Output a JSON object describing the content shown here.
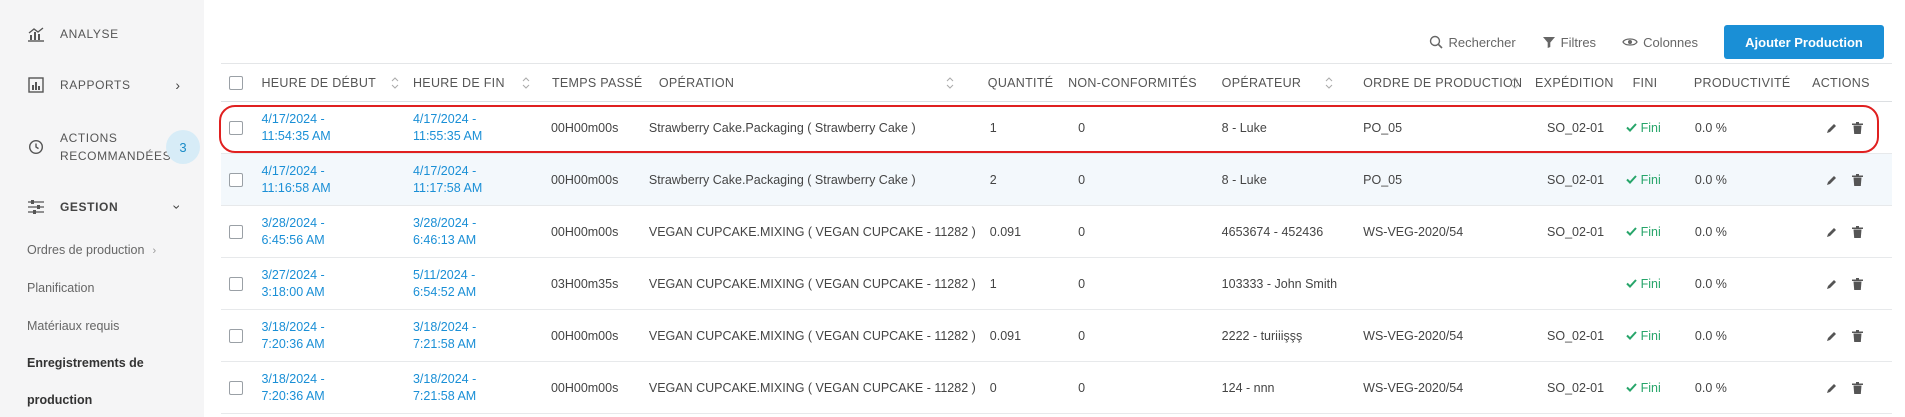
{
  "sidebar": {
    "analyse": "ANALYSE",
    "rapports": "RAPPORTS",
    "actions_line1": "ACTIONS",
    "actions_line2": "RECOMMANDÉES",
    "actions_badge": "3",
    "gestion": "GESTION",
    "sub_items": [
      "Ordres de production",
      "Planification",
      "Matériaux requis"
    ],
    "active_line1": "Enregistrements de",
    "active_line2": "production"
  },
  "toolbar": {
    "search": "Rechercher",
    "filters": "Filtres",
    "columns": "Colonnes",
    "add": "Ajouter Production"
  },
  "table": {
    "headers": [
      "HEURE DE DÉBUT",
      "HEURE DE FIN",
      "TEMPS PASSÉ",
      "OPÉRATION",
      "QUANTITÉ",
      "NON-CONFORMITÉS",
      "OPÉRATEUR",
      "ORDRE DE PRODUCTION",
      "EXPÉDITION",
      "FINI",
      "PRODUCTIVITÉ",
      "ACTIONS"
    ],
    "rows": [
      {
        "start1": "4/17/2024 -",
        "start2": "11:54:35 AM",
        "end1": "4/17/2024 -",
        "end2": "11:55:35 AM",
        "time": "00H00m00s",
        "op": "Strawberry Cake.Packaging ( Strawberry Cake )",
        "qty": "1",
        "nc": "0",
        "operator": "8 - Luke",
        "order": "PO_05",
        "exp": "SO_02-01",
        "fini": "Fini",
        "prod": "0.0 %"
      },
      {
        "start1": "4/17/2024 -",
        "start2": "11:16:58 AM",
        "end1": "4/17/2024 -",
        "end2": "11:17:58 AM",
        "time": "00H00m00s",
        "op": "Strawberry Cake.Packaging ( Strawberry Cake )",
        "qty": "2",
        "nc": "0",
        "operator": "8 - Luke",
        "order": "PO_05",
        "exp": "SO_02-01",
        "fini": "Fini",
        "prod": "0.0 %"
      },
      {
        "start1": "3/28/2024 -",
        "start2": "6:45:56 AM",
        "end1": "3/28/2024 -",
        "end2": "6:46:13 AM",
        "time": "00H00m00s",
        "op": "VEGAN CUPCAKE.MIXING ( VEGAN CUPCAKE - 11282 )",
        "qty": "0.091",
        "nc": "0",
        "operator": "4653674 - 452436",
        "order": "WS-VEG-2020/54",
        "exp": "SO_02-01",
        "fini": "Fini",
        "prod": "0.0 %"
      },
      {
        "start1": "3/27/2024 -",
        "start2": "3:18:00 AM",
        "end1": "5/11/2024 -",
        "end2": "6:54:52 AM",
        "time": "03H00m35s",
        "op": "VEGAN CUPCAKE.MIXING ( VEGAN CUPCAKE - 11282 )",
        "qty": "1",
        "nc": "0",
        "operator": "103333 - John Smith",
        "order": "",
        "exp": "",
        "fini": "Fini",
        "prod": "0.0 %"
      },
      {
        "start1": "3/18/2024 -",
        "start2": "7:20:36 AM",
        "end1": "3/18/2024 -",
        "end2": "7:21:58 AM",
        "time": "00H00m00s",
        "op": "VEGAN CUPCAKE.MIXING ( VEGAN CUPCAKE - 11282 )",
        "qty": "0.091",
        "nc": "0",
        "operator": "2222 - turiiişşş",
        "order": "WS-VEG-2020/54",
        "exp": "SO_02-01",
        "fini": "Fini",
        "prod": "0.0 %"
      },
      {
        "start1": "3/18/2024 -",
        "start2": "7:20:36 AM",
        "end1": "3/18/2024 -",
        "end2": "7:21:58 AM",
        "time": "00H00m00s",
        "op": "VEGAN CUPCAKE.MIXING ( VEGAN CUPCAKE - 11282 )",
        "qty": "0",
        "nc": "0",
        "operator": "124 - nnn",
        "order": "WS-VEG-2020/54",
        "exp": "SO_02-01",
        "fini": "Fini",
        "prod": "0.0 %"
      }
    ]
  },
  "colors": {
    "accent": "#1a8fd6",
    "success": "#27a56a",
    "highlight": "#e02020"
  }
}
